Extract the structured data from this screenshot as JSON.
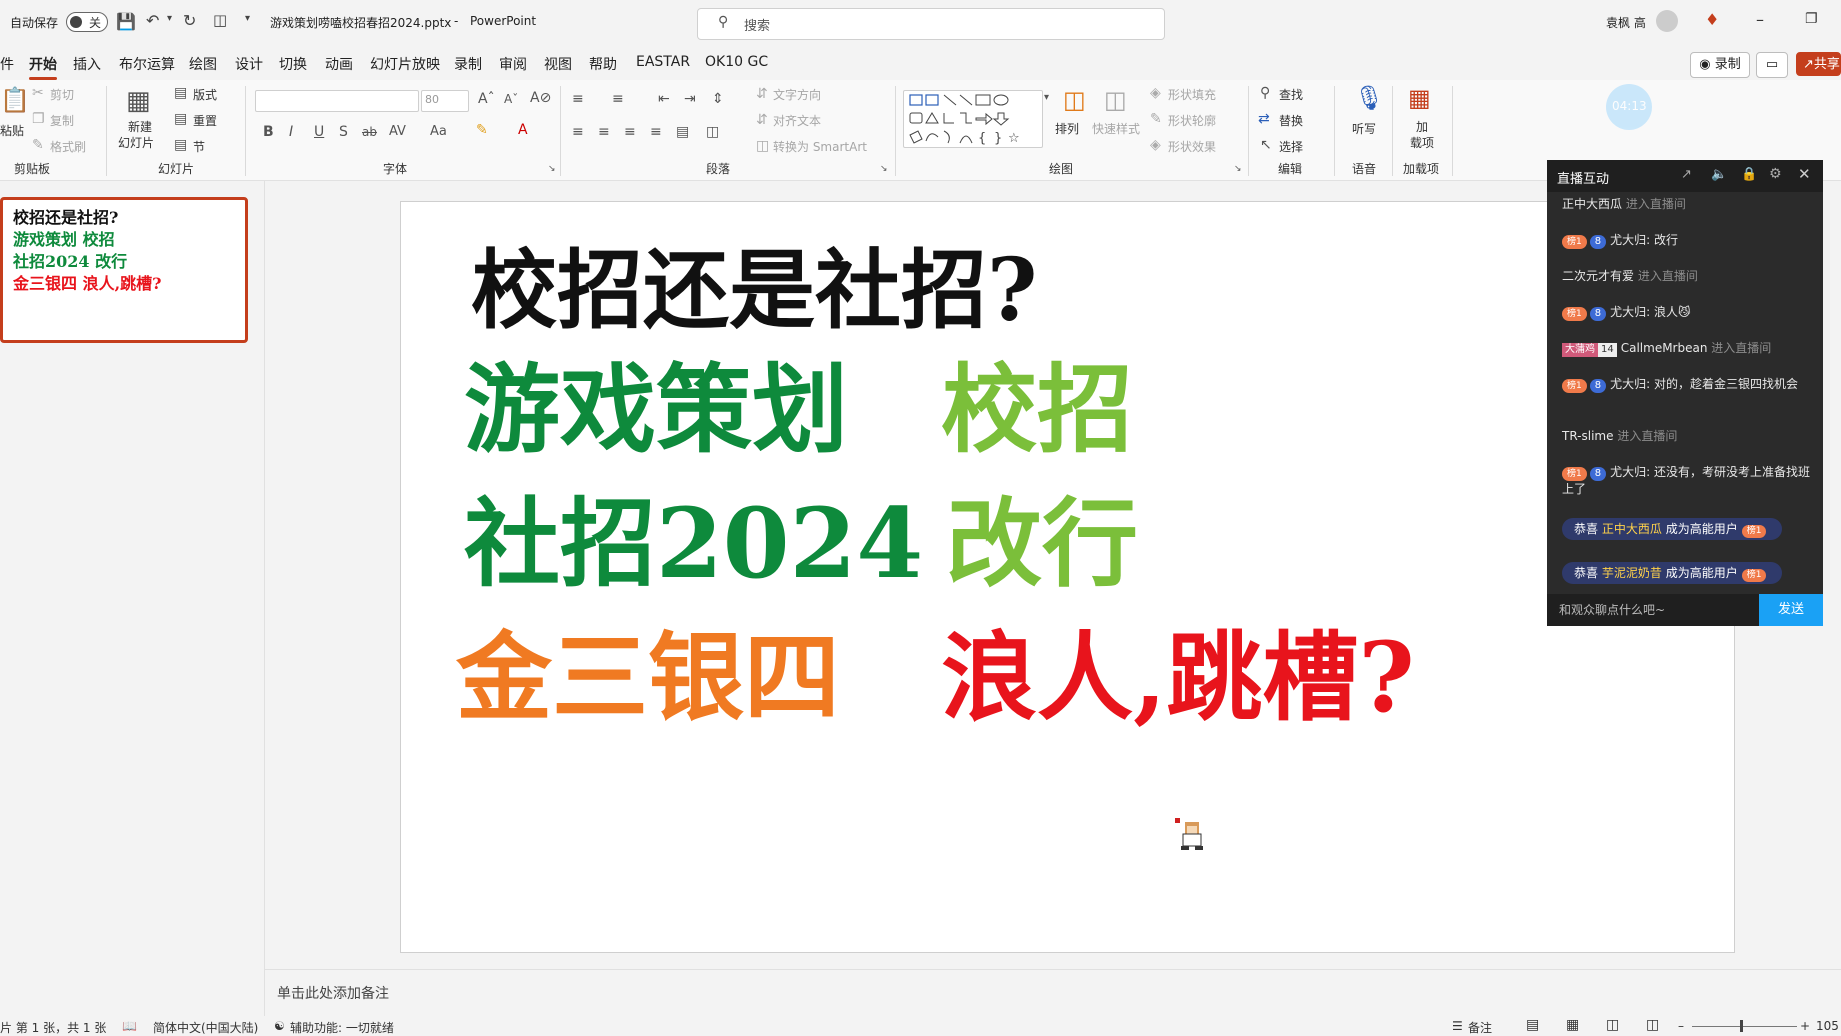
{
  "titlebar": {
    "autosave_label": "自动保存",
    "autosave_state": "关",
    "document_title": "游戏策划唠嗑校招春招2024.pptx",
    "app_sep": "-",
    "app_name": "PowerPoint",
    "search_placeholder": "搜索",
    "user_name": "袁枫 高"
  },
  "menu": {
    "tabs": [
      "件",
      "开始",
      "插入",
      "布尔运算",
      "绘图",
      "设计",
      "切换",
      "动画",
      "幻灯片放映",
      "录制",
      "审阅",
      "视图",
      "帮助",
      "EASTAR",
      "OK10 GC"
    ],
    "active_index": 1,
    "record_button": "录制",
    "share_button": "共享"
  },
  "ribbon": {
    "clipboard": {
      "paste": "粘贴",
      "cut": "剪切",
      "copy": "复制",
      "format_painter": "格式刷",
      "group": "剪贴板"
    },
    "slides": {
      "new_slide_1": "新建",
      "new_slide_2": "幻灯片",
      "layout": "版式",
      "reset": "重置",
      "section": "节",
      "group": "幻灯片"
    },
    "font": {
      "font_size": "80",
      "bold": "B",
      "italic": "I",
      "underline": "U",
      "shadow": "S",
      "strike": "ab",
      "spacing": "AV",
      "case": "Aa",
      "group": "字体"
    },
    "paragraph": {
      "text_direction": "文字方向",
      "align_text": "对齐文本",
      "smartart": "转换为 SmartArt",
      "group": "段落"
    },
    "drawing": {
      "arrange": "排列",
      "quick_styles": "快速样式",
      "shape_fill": "形状填充",
      "shape_outline": "形状轮廓",
      "shape_effects": "形状效果",
      "group": "绘图"
    },
    "editing": {
      "find": "查找",
      "replace": "替换",
      "select": "选择",
      "group": "编辑"
    },
    "voice": {
      "dictate": "听写",
      "group": "语音"
    },
    "addins": {
      "addins_1": "加",
      "addins_2": "载项",
      "group": "加载项"
    },
    "timer": "04:13"
  },
  "thumbnail": {
    "lines": [
      "校招还是社招?",
      "游戏策划 校招",
      "社招2024 改行",
      "金三银四 浪人,跳槽?"
    ]
  },
  "slide": {
    "line1": "校招还是社招?",
    "line2a": "游戏策划",
    "line2b": "校招",
    "line3a": "社招2024",
    "line3b": "改行",
    "line4a": "金三银四",
    "line4b": "浪人,跳槽?"
  },
  "notes": {
    "placeholder": "单击此处添加备注"
  },
  "status": {
    "slide_info": "片 第 1 张，共 1 张",
    "language": "简体中文(中国大陆)",
    "accessibility": "辅助功能: 一切就绪",
    "notes_button": "备注",
    "zoom": "105"
  },
  "live_panel": {
    "title": "直播互动",
    "messages": [
      {
        "type": "enter",
        "user": "正中大西瓜",
        "text": "进入直播间"
      },
      {
        "type": "chat",
        "level": "榜1",
        "fan": "8",
        "user": "尤大归",
        "text": "改行"
      },
      {
        "type": "enter",
        "user": "二次元才有爱",
        "text": "进入直播间"
      },
      {
        "type": "chat",
        "level": "榜1",
        "fan": "8",
        "user": "尤大归",
        "text": "浪人😼"
      },
      {
        "type": "enter_tag",
        "tag": "大蒲鸡",
        "tag_num": "14",
        "user": "CallmeMrbean",
        "text": "进入直播间"
      },
      {
        "type": "chat",
        "level": "榜1",
        "fan": "8",
        "user": "尤大归",
        "text": "对的，趁着金三银四找机会"
      },
      {
        "type": "enter",
        "user": "TR-slime",
        "text": "进入直播间"
      },
      {
        "type": "chat",
        "level": "榜1",
        "fan": "8",
        "user": "尤大归",
        "text": "还没有，考研没考上准备找班上了"
      }
    ],
    "congrats": [
      {
        "prefix": "恭喜",
        "user": "正中大西瓜",
        "suffix": "成为高能用户",
        "badge": "榜1"
      },
      {
        "prefix": "恭喜",
        "user": "芋泥泥奶昔",
        "suffix": "成为高能用户",
        "badge": "榜1"
      }
    ],
    "input_placeholder": "和观众聊点什么吧~",
    "send_button": "发送"
  },
  "colors": {
    "accent": "#c43e1c",
    "slide_black": "#111111",
    "slide_dark_green": "#0e8a3c",
    "slide_light_green": "#7bbf3a",
    "slide_orange": "#f07a22",
    "slide_red": "#e8141c",
    "send_blue": "#1aa1f5"
  }
}
